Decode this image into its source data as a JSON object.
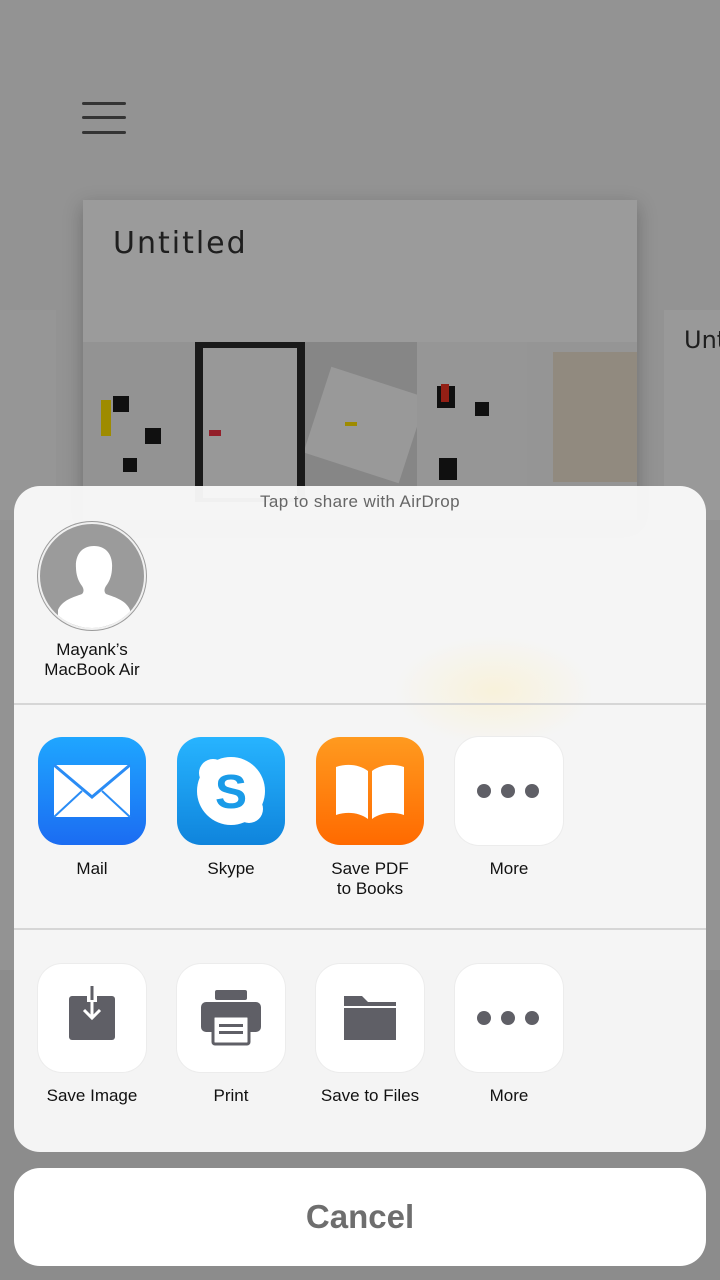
{
  "background": {
    "canvas_title": "Untitled",
    "side_card_title": "Unt"
  },
  "share_sheet": {
    "airdrop_hint": "Tap to share with AirDrop",
    "airdrop_device": {
      "name_line1": "Mayank’s",
      "name_line2": "MacBook Air"
    },
    "apps": [
      {
        "label": "Mail",
        "icon": "mail-icon"
      },
      {
        "label": "Skype",
        "icon": "skype-icon"
      },
      {
        "label_line1": "Save PDF",
        "label_line2": "to Books",
        "icon": "books-icon"
      },
      {
        "label": "More",
        "icon": "more-icon"
      }
    ],
    "actions": [
      {
        "label": "Save Image",
        "icon": "save-image-icon"
      },
      {
        "label": "Print",
        "icon": "printer-icon"
      },
      {
        "label": "Save to Files",
        "icon": "folder-icon"
      },
      {
        "label": "More",
        "icon": "more-icon"
      }
    ]
  },
  "cancel_label": "Cancel",
  "colors": {
    "mail": "#1b8cf8",
    "skype": "#1a9be8",
    "books": "#ff7d0f",
    "action_glyph": "#5f5f66"
  }
}
